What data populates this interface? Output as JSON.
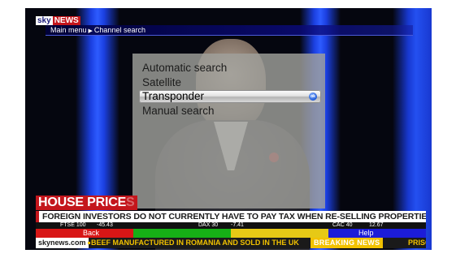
{
  "channel_logo": {
    "sky": "sky",
    "news": "NEWS"
  },
  "breadcrumb": {
    "root": "Main menu",
    "current": "Channel search"
  },
  "menu": {
    "items": [
      {
        "label": "Automatic search",
        "selected": false
      },
      {
        "label": "Satellite",
        "selected": false
      },
      {
        "label": "Transponder",
        "selected": true
      },
      {
        "label": "Manual search",
        "selected": false
      }
    ],
    "ok_icon": "ok"
  },
  "broadcast": {
    "headline": "HOUSE PRICE",
    "headline_faded": "S",
    "ticker": "FOREIGN INVESTORS DO NOT CURRENTLY HAVE TO PAY TAX WHEN RE-SELLING PROPERTIES",
    "markets": [
      {
        "index": "FTSE 100",
        "change": "-45.43"
      },
      {
        "index": "DAX 30",
        "change": "-7.41"
      },
      {
        "index": "CAC 40",
        "change": "12.67"
      }
    ],
    "website": "skynews.com",
    "story": "BEEF MANUFACTURED IN ROMANIA AND SOLD IN THE UK",
    "breaking": "BREAKING NEWS",
    "story2": "PRISON SE"
  },
  "color_keys": {
    "red_label": "Back",
    "blue_label": "Help"
  },
  "colors": {
    "sky_red": "#c4161c",
    "key_red": "#d81616",
    "key_green": "#16b016",
    "key_yellow": "#e6c916",
    "key_blue": "#1c1cd8",
    "menu_panel": "#a0a09b"
  }
}
